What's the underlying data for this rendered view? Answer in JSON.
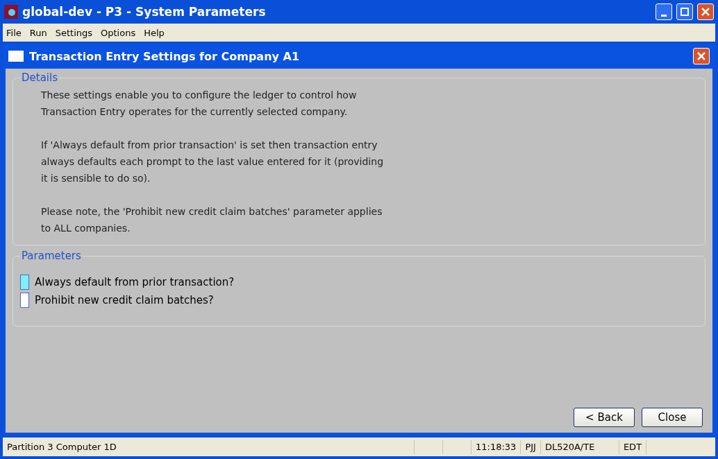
{
  "window": {
    "title": "global-dev - P3 - System Parameters"
  },
  "menu": [
    "File",
    "Run",
    "Settings",
    "Options",
    "Help"
  ],
  "dialog": {
    "title": "Transaction Entry Settings for Company A1",
    "details": {
      "legend": "Details",
      "paragraphs": [
        "These settings enable you to configure the ledger to control how Transaction Entry operates for the currently selected company.",
        "If 'Always default from prior transaction' is set then transaction entry always defaults each prompt to the last value entered for it (providing it is sensible to do so).",
        "Please note, the 'Prohibit new credit claim batches' parameter applies to ALL companies."
      ]
    },
    "parameters": {
      "legend": "Parameters",
      "items": [
        {
          "label": "Always default from prior transaction?",
          "focused": true
        },
        {
          "label": "Prohibit new credit claim batches?",
          "focused": false
        }
      ]
    },
    "buttons": [
      "< Back",
      "Close"
    ]
  },
  "status_bar": [
    "Partition 3 Computer 1D",
    "11:18:33",
    "PJJ",
    "DL520A/TE",
    "EDT"
  ]
}
